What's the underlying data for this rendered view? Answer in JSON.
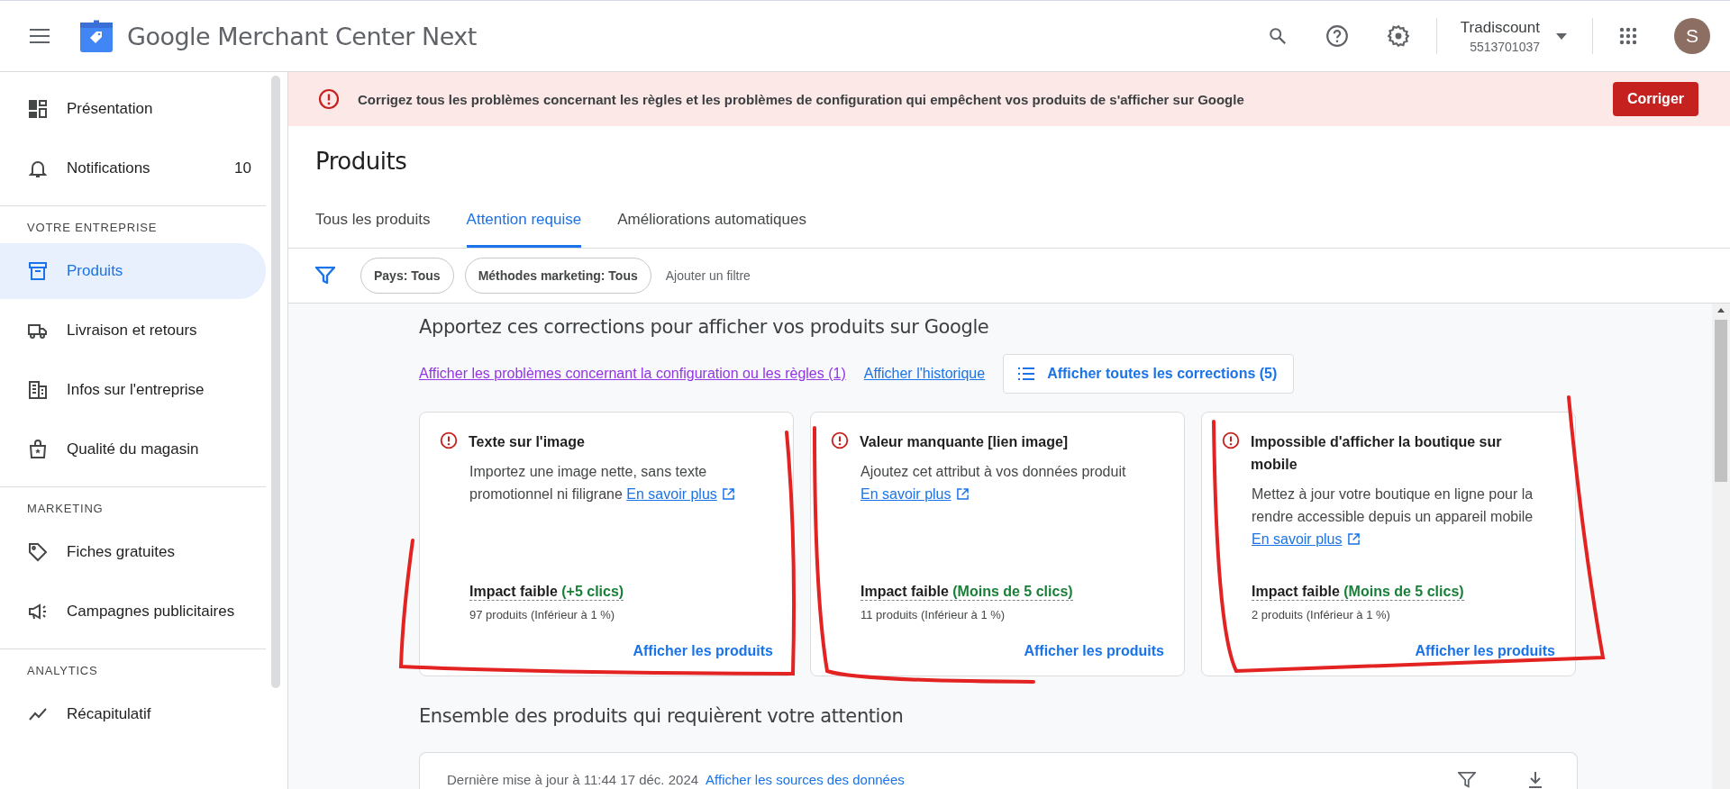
{
  "header": {
    "product_name": "Google Merchant Center Next",
    "account": {
      "name": "Tradiscount",
      "id": "5513701037"
    },
    "avatar_letter": "S"
  },
  "sidebar": {
    "groups": [
      {
        "items": [
          {
            "label": "Présentation",
            "kind": "dashboard",
            "selected": false
          },
          {
            "label": "Notifications",
            "kind": "bell",
            "selected": false,
            "count": "10"
          }
        ]
      },
      {
        "heading": "VOTRE ENTREPRISE",
        "items": [
          {
            "label": "Produits",
            "kind": "box",
            "selected": true
          },
          {
            "label": "Livraison et retours",
            "kind": "truck",
            "selected": false
          },
          {
            "label": "Infos sur l'entreprise",
            "kind": "building",
            "selected": false
          },
          {
            "label": "Qualité du magasin",
            "kind": "bag",
            "selected": false
          }
        ]
      },
      {
        "heading": "MARKETING",
        "items": [
          {
            "label": "Fiches gratuites",
            "kind": "tag",
            "selected": false
          },
          {
            "label": "Campagnes publicitaires",
            "kind": "megaphone",
            "selected": false
          }
        ]
      },
      {
        "heading": "ANALYTICS",
        "items": [
          {
            "label": "Récapitulatif",
            "kind": "trend",
            "selected": false
          }
        ]
      }
    ]
  },
  "banner": {
    "message": "Corrigez tous les problèmes concernant les règles et les problèmes de configuration qui empêchent vos produits de s'afficher sur Google",
    "button": "Corriger"
  },
  "page_title": "Produits",
  "tabs": [
    {
      "label": "Tous les produits",
      "selected": false
    },
    {
      "label": "Attention requise",
      "selected": true
    },
    {
      "label": "Améliorations automatiques",
      "selected": false
    }
  ],
  "filters": {
    "chips": [
      "Pays: Tous",
      "Méthodes marketing: Tous"
    ],
    "add_filter": "Ajouter un filtre"
  },
  "fixes": {
    "heading": "Apportez ces corrections pour afficher vos produits sur Google",
    "links": [
      {
        "label": "Afficher les problèmes concernant la configuration ou les règles (1)",
        "visited": true
      },
      {
        "label": "Afficher l'historique",
        "visited": false
      }
    ],
    "show_all_button": "Afficher toutes les corrections (5)",
    "cards": [
      {
        "title": "Texte sur l'image",
        "description": "Importez une image nette, sans texte promotionnel ni filigrane",
        "link": "En savoir plus",
        "impact_label": "Impact faible",
        "impact_value": "(+5 clics)",
        "products": "97 produits (Inférieur à 1 %)",
        "action": "Afficher les produits"
      },
      {
        "title": "Valeur manquante [lien image]",
        "description": "Ajoutez cet attribut à vos données produit",
        "link": "En savoir plus",
        "impact_label": "Impact faible",
        "impact_value": "(Moins de 5 clics)",
        "products": "11 produits (Inférieur à 1 %)",
        "action": "Afficher les produits"
      },
      {
        "title": "Impossible d'afficher la boutique sur mobile",
        "description": "Mettez à jour votre boutique en ligne pour la rendre accessible depuis un appareil mobile",
        "link": "En savoir plus",
        "impact_label": "Impact faible",
        "impact_value": "(Moins de 5 clics)",
        "products": "2 produits (Inférieur à 1 %)",
        "action": "Afficher les produits"
      }
    ]
  },
  "attention": {
    "heading": "Ensemble des produits qui requièrent votre attention",
    "last_update": "Dernière mise à jour à 11:44 17 déc. 2024",
    "sources_link": "Afficher les sources des données"
  }
}
